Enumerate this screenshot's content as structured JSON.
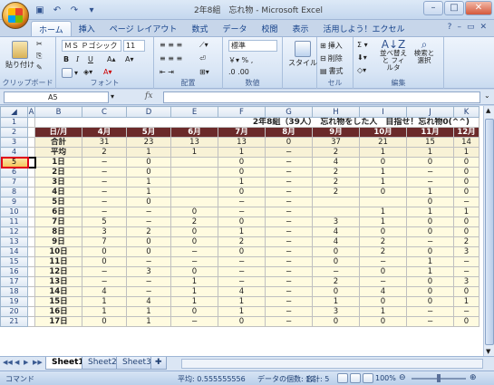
{
  "window": {
    "title": "2年8組　忘れ物 - Microsoft Excel"
  },
  "ribbon_tabs": [
    "ホーム",
    "挿入",
    "ページ レイアウト",
    "数式",
    "データ",
    "校閲",
    "表示",
    "活用しよう！エクセル"
  ],
  "ribbon": {
    "paste": "貼り付け",
    "font_name": "ＭＳ Ｐゴシック",
    "font_size": "11",
    "number_format": "標準",
    "style": "スタイル",
    "insert": "挿入",
    "delete": "削除",
    "format": "書式",
    "sort_filter": "並べ替えと フィルタ",
    "find_select": "検索と 選択",
    "groups": [
      "クリップボード",
      "フォント",
      "配置",
      "数値",
      "セル",
      "編集"
    ]
  },
  "formula_bar": {
    "namebox": "A5",
    "fx": "fx",
    "value": ""
  },
  "columns": [
    "A",
    "B",
    "C",
    "D",
    "E",
    "F",
    "G",
    "H",
    "I",
    "J",
    "K"
  ],
  "row_numbers": [
    "1",
    "2",
    "3",
    "4",
    "5",
    "6",
    "7",
    "8",
    "9",
    "10",
    "11",
    "12",
    "13",
    "14",
    "15",
    "16",
    "17",
    "18",
    "19",
    "20",
    "21"
  ],
  "sheet": {
    "title": "2年8組（39人）　忘れ物をした人　目指せ！忘れ物0(^^)",
    "header": [
      "日/月",
      "4月",
      "5月",
      "6月",
      "7月",
      "8月",
      "9月",
      "10月",
      "11月",
      "12月"
    ],
    "totals": [
      "合計",
      "31",
      "23",
      "13",
      "13",
      "0",
      "37",
      "21",
      "15",
      "14"
    ],
    "averages": [
      "平均",
      "2",
      "1",
      "1",
      "1",
      "−",
      "2",
      "1",
      "1",
      "1"
    ],
    "days": [
      [
        "1日",
        "−",
        "0",
        "",
        "0",
        "−",
        "4",
        "0",
        "0",
        "0"
      ],
      [
        "2日",
        "−",
        "0",
        "",
        "0",
        "−",
        "2",
        "1",
        "−",
        "0"
      ],
      [
        "3日",
        "−",
        "1",
        "",
        "1",
        "−",
        "2",
        "1",
        "−",
        "0"
      ],
      [
        "4日",
        "−",
        "1",
        "",
        "0",
        "−",
        "2",
        "0",
        "1",
        "0"
      ],
      [
        "5日",
        "−",
        "0",
        "",
        "−",
        "−",
        "",
        "",
        "0",
        "−"
      ],
      [
        "6日",
        "−",
        "−",
        "0",
        "−",
        "−",
        "",
        "1",
        "1",
        "1"
      ],
      [
        "7日",
        "5",
        "−",
        "2",
        "0",
        "−",
        "3",
        "1",
        "0",
        "0"
      ],
      [
        "8日",
        "3",
        "2",
        "0",
        "1",
        "−",
        "4",
        "0",
        "0",
        "0"
      ],
      [
        "9日",
        "7",
        "0",
        "0",
        "2",
        "−",
        "4",
        "2",
        "−",
        "2"
      ],
      [
        "10日",
        "0",
        "0",
        "−",
        "0",
        "−",
        "0",
        "2",
        "0",
        "3"
      ],
      [
        "11日",
        "0",
        "−",
        "−",
        "−",
        "−",
        "0",
        "−",
        "1",
        "−"
      ],
      [
        "12日",
        "−",
        "3",
        "0",
        "−",
        "−",
        "−",
        "0",
        "1",
        "−"
      ],
      [
        "13日",
        "−",
        "−",
        "1",
        "−",
        "−",
        "2",
        "−",
        "0",
        "3"
      ],
      [
        "14日",
        "4",
        "−",
        "1",
        "4",
        "−",
        "0",
        "4",
        "0",
        "0"
      ],
      [
        "15日",
        "1",
        "4",
        "1",
        "1",
        "−",
        "1",
        "0",
        "0",
        "1"
      ],
      [
        "16日",
        "1",
        "1",
        "0",
        "1",
        "−",
        "3",
        "1",
        "−",
        "−"
      ],
      [
        "17日",
        "0",
        "1",
        "−",
        "0",
        "−",
        "0",
        "0",
        "−",
        "0"
      ]
    ]
  },
  "sheet_tabs": [
    "Sheet1",
    "Sheet2",
    "Sheet3"
  ],
  "status": {
    "mode": "コマンド",
    "average": "平均: 0.555555556",
    "count": "データの個数: 12",
    "sum": "合計: 5",
    "zoom": "100%"
  },
  "colors": {
    "header_bg": "#6b2a2a",
    "cell_bg": "#fffbe0",
    "highlight": "#e0001a"
  }
}
